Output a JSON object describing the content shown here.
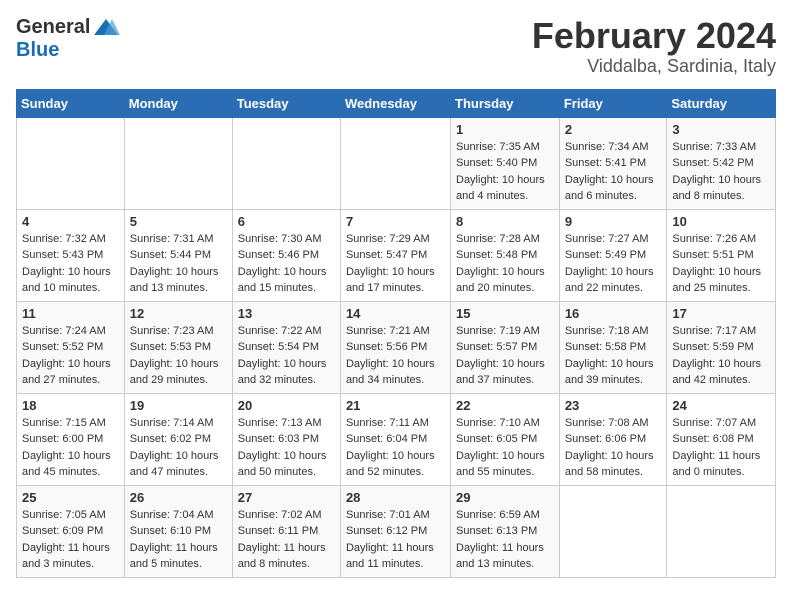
{
  "logo": {
    "general": "General",
    "blue": "Blue"
  },
  "title": {
    "month": "February 2024",
    "location": "Viddalba, Sardinia, Italy"
  },
  "weekdays": [
    "Sunday",
    "Monday",
    "Tuesday",
    "Wednesday",
    "Thursday",
    "Friday",
    "Saturday"
  ],
  "weeks": [
    [
      {
        "day": "",
        "info": ""
      },
      {
        "day": "",
        "info": ""
      },
      {
        "day": "",
        "info": ""
      },
      {
        "day": "",
        "info": ""
      },
      {
        "day": "1",
        "info": "Sunrise: 7:35 AM\nSunset: 5:40 PM\nDaylight: 10 hours\nand 4 minutes."
      },
      {
        "day": "2",
        "info": "Sunrise: 7:34 AM\nSunset: 5:41 PM\nDaylight: 10 hours\nand 6 minutes."
      },
      {
        "day": "3",
        "info": "Sunrise: 7:33 AM\nSunset: 5:42 PM\nDaylight: 10 hours\nand 8 minutes."
      }
    ],
    [
      {
        "day": "4",
        "info": "Sunrise: 7:32 AM\nSunset: 5:43 PM\nDaylight: 10 hours\nand 10 minutes."
      },
      {
        "day": "5",
        "info": "Sunrise: 7:31 AM\nSunset: 5:44 PM\nDaylight: 10 hours\nand 13 minutes."
      },
      {
        "day": "6",
        "info": "Sunrise: 7:30 AM\nSunset: 5:46 PM\nDaylight: 10 hours\nand 15 minutes."
      },
      {
        "day": "7",
        "info": "Sunrise: 7:29 AM\nSunset: 5:47 PM\nDaylight: 10 hours\nand 17 minutes."
      },
      {
        "day": "8",
        "info": "Sunrise: 7:28 AM\nSunset: 5:48 PM\nDaylight: 10 hours\nand 20 minutes."
      },
      {
        "day": "9",
        "info": "Sunrise: 7:27 AM\nSunset: 5:49 PM\nDaylight: 10 hours\nand 22 minutes."
      },
      {
        "day": "10",
        "info": "Sunrise: 7:26 AM\nSunset: 5:51 PM\nDaylight: 10 hours\nand 25 minutes."
      }
    ],
    [
      {
        "day": "11",
        "info": "Sunrise: 7:24 AM\nSunset: 5:52 PM\nDaylight: 10 hours\nand 27 minutes."
      },
      {
        "day": "12",
        "info": "Sunrise: 7:23 AM\nSunset: 5:53 PM\nDaylight: 10 hours\nand 29 minutes."
      },
      {
        "day": "13",
        "info": "Sunrise: 7:22 AM\nSunset: 5:54 PM\nDaylight: 10 hours\nand 32 minutes."
      },
      {
        "day": "14",
        "info": "Sunrise: 7:21 AM\nSunset: 5:56 PM\nDaylight: 10 hours\nand 34 minutes."
      },
      {
        "day": "15",
        "info": "Sunrise: 7:19 AM\nSunset: 5:57 PM\nDaylight: 10 hours\nand 37 minutes."
      },
      {
        "day": "16",
        "info": "Sunrise: 7:18 AM\nSunset: 5:58 PM\nDaylight: 10 hours\nand 39 minutes."
      },
      {
        "day": "17",
        "info": "Sunrise: 7:17 AM\nSunset: 5:59 PM\nDaylight: 10 hours\nand 42 minutes."
      }
    ],
    [
      {
        "day": "18",
        "info": "Sunrise: 7:15 AM\nSunset: 6:00 PM\nDaylight: 10 hours\nand 45 minutes."
      },
      {
        "day": "19",
        "info": "Sunrise: 7:14 AM\nSunset: 6:02 PM\nDaylight: 10 hours\nand 47 minutes."
      },
      {
        "day": "20",
        "info": "Sunrise: 7:13 AM\nSunset: 6:03 PM\nDaylight: 10 hours\nand 50 minutes."
      },
      {
        "day": "21",
        "info": "Sunrise: 7:11 AM\nSunset: 6:04 PM\nDaylight: 10 hours\nand 52 minutes."
      },
      {
        "day": "22",
        "info": "Sunrise: 7:10 AM\nSunset: 6:05 PM\nDaylight: 10 hours\nand 55 minutes."
      },
      {
        "day": "23",
        "info": "Sunrise: 7:08 AM\nSunset: 6:06 PM\nDaylight: 10 hours\nand 58 minutes."
      },
      {
        "day": "24",
        "info": "Sunrise: 7:07 AM\nSunset: 6:08 PM\nDaylight: 11 hours\nand 0 minutes."
      }
    ],
    [
      {
        "day": "25",
        "info": "Sunrise: 7:05 AM\nSunset: 6:09 PM\nDaylight: 11 hours\nand 3 minutes."
      },
      {
        "day": "26",
        "info": "Sunrise: 7:04 AM\nSunset: 6:10 PM\nDaylight: 11 hours\nand 5 minutes."
      },
      {
        "day": "27",
        "info": "Sunrise: 7:02 AM\nSunset: 6:11 PM\nDaylight: 11 hours\nand 8 minutes."
      },
      {
        "day": "28",
        "info": "Sunrise: 7:01 AM\nSunset: 6:12 PM\nDaylight: 11 hours\nand 11 minutes."
      },
      {
        "day": "29",
        "info": "Sunrise: 6:59 AM\nSunset: 6:13 PM\nDaylight: 11 hours\nand 13 minutes."
      },
      {
        "day": "",
        "info": ""
      },
      {
        "day": "",
        "info": ""
      }
    ]
  ]
}
